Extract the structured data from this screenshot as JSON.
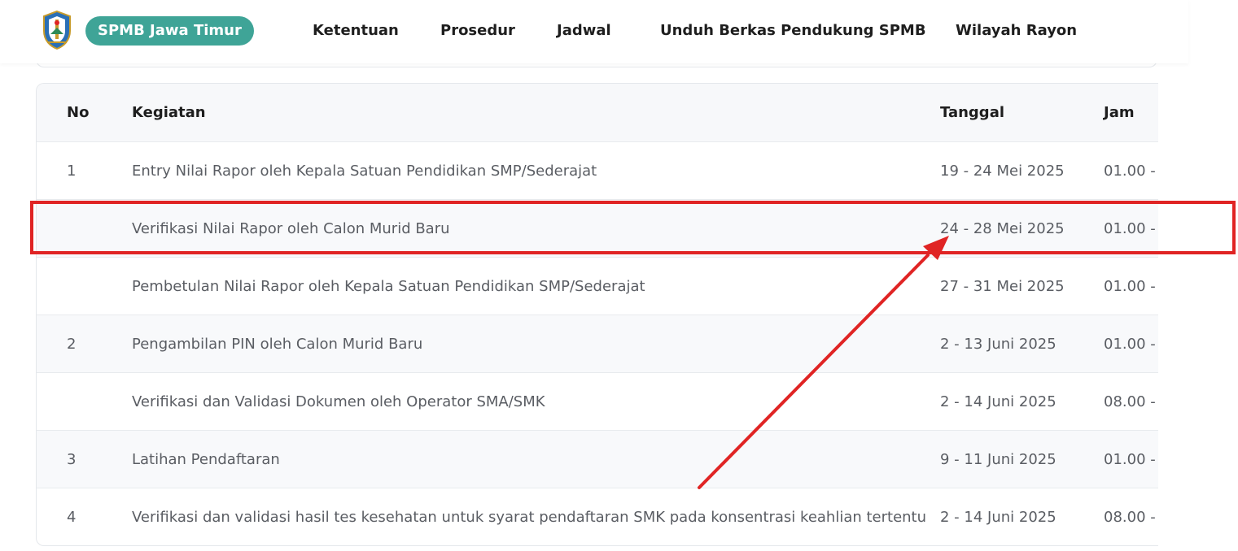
{
  "header": {
    "brand": "SPMB Jawa Timur",
    "nav": [
      "Ketentuan",
      "Prosedur",
      "Jadwal",
      "Unduh Berkas Pendukung SPMB",
      "Wilayah Rayon"
    ]
  },
  "table": {
    "columns": {
      "no": "No",
      "kegiatan": "Kegiatan",
      "tanggal": "Tanggal",
      "jam": "Jam"
    },
    "rows": [
      {
        "no": "1",
        "kegiatan": "Entry Nilai Rapor oleh Kepala Satuan Pendidikan SMP/Sederajat",
        "tanggal": "19 - 24 Mei 2025",
        "jam": "01.00 -"
      },
      {
        "no": "",
        "kegiatan": "Verifikasi Nilai Rapor oleh Calon Murid Baru",
        "tanggal": "24 - 28 Mei 2025",
        "jam": "01.00 -"
      },
      {
        "no": "",
        "kegiatan": "Pembetulan Nilai Rapor oleh Kepala Satuan Pendidikan SMP/Sederajat",
        "tanggal": "27 - 31 Mei 2025",
        "jam": "01.00 -"
      },
      {
        "no": "2",
        "kegiatan": "Pengambilan PIN oleh Calon Murid Baru",
        "tanggal": "2 - 13 Juni 2025",
        "jam": "01.00 -"
      },
      {
        "no": "",
        "kegiatan": "Verifikasi dan Validasi Dokumen oleh Operator SMA/SMK",
        "tanggal": "2 - 14 Juni 2025",
        "jam": "08.00 -"
      },
      {
        "no": "3",
        "kegiatan": "Latihan Pendaftaran",
        "tanggal": "9 - 11 Juni 2025",
        "jam": "01.00 -"
      },
      {
        "no": "4",
        "kegiatan": "Verifikasi dan validasi hasil tes kesehatan untuk syarat pendaftaran SMK pada konsentrasi keahlian tertentu",
        "tanggal": "2 - 14 Juni 2025",
        "jam": "08.00 -"
      }
    ]
  },
  "colors": {
    "brand": "#3fa497",
    "annotation": "#e02424"
  },
  "icons": {
    "logo": "jawa-timur-emblem-icon"
  }
}
